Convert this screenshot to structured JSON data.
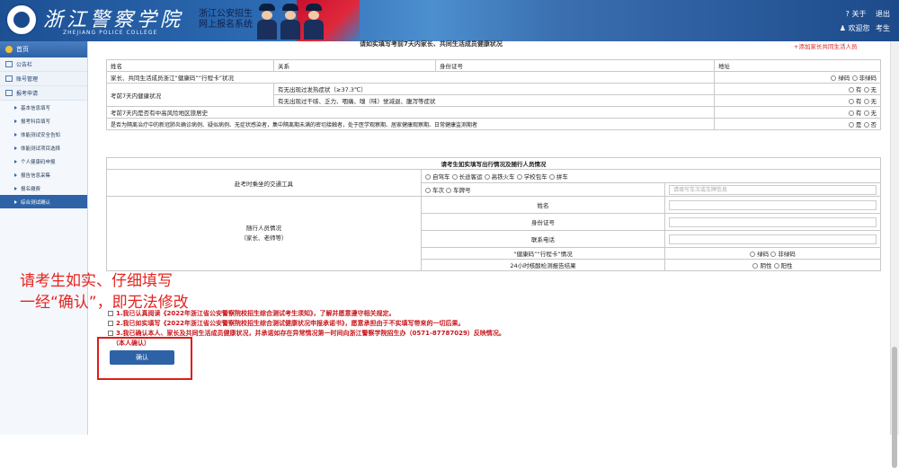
{
  "header": {
    "brand": "浙江警察学院",
    "brand_en": "ZHEJIANG POLICE COLLEGE",
    "subtitle_1": "浙江公安招生",
    "subtitle_2": "网上报名系统",
    "about": "关于",
    "logout": "退出",
    "welcome": "欢迎您",
    "user": "考生"
  },
  "sidebar": {
    "home": "首页",
    "groups": [
      {
        "label": "公告栏"
      },
      {
        "label": "账号管理"
      },
      {
        "label": "报考申请"
      }
    ],
    "items": [
      {
        "label": "基本信息填写"
      },
      {
        "label": "报考科目填写"
      },
      {
        "label": "体能测试安全告知"
      },
      {
        "label": "体能测试项目选择"
      },
      {
        "label": "个人健康码申报"
      },
      {
        "label": "报告信息采集"
      },
      {
        "label": "报名缴费"
      },
      {
        "label": "综合测试确认"
      }
    ]
  },
  "health": {
    "section_title": "请如实填写考前7天内家长、共同生活成员健康状况",
    "add_link": "+添加家长共同生活人员",
    "cols": [
      "姓名",
      "关系",
      "身份证号",
      "地址"
    ],
    "rows": [
      {
        "label": "家长、共同生活成员浙江“健康码”“行程卡”状况",
        "opt_a": "绿码",
        "opt_b": "非绿码"
      },
      {
        "label": "考前7天内健康状况",
        "sub1": "有无出现过发热症状（≥37.3℃）",
        "sub2": "有无出现过干咳、乏力、咽痛、嗅（味）觉减退、腹泻等症状",
        "opt_a": "有",
        "opt_b": "无"
      },
      {
        "label": "考前7天内是否有中高风险地区旅居史",
        "opt_a": "有",
        "opt_b": "无"
      },
      {
        "label": "是否为隔离治疗中的新冠肺炎确诊病例、疑似病例、无症状感染者，集中隔离期未满的密切接触者，处于医学观察期、居家健康观察期、日常健康监测期者",
        "opt_a": "是",
        "opt_b": "否"
      }
    ]
  },
  "travel": {
    "title": "请考生如实填写出行情况及随行人员情况",
    "transport_label": "赴考时乘坐的交通工具",
    "options_row1": [
      "自驾车",
      "长途客运",
      "高铁火车",
      "学校包车",
      "拼车"
    ],
    "options_row2": [
      "车次",
      "车牌号"
    ],
    "transport_placeholder": "请填写车次或车牌信息",
    "companion_label": "随行人员情况",
    "companion_sub": "（家长、老师等）",
    "fields": [
      "姓名",
      "身份证号",
      "联系电话"
    ],
    "health_code_label": "“健康码”“行程卡”情况",
    "health_code_opts": [
      "绿码",
      "非绿码"
    ],
    "test_label": "24小时核酸检测报告结果",
    "test_opts": [
      "阴性",
      "阳性"
    ]
  },
  "consents": [
    "1.我已认真阅读《2022年浙江省公安警察院校招生综合测试考生须知》，了解并愿意遵守相关规定。",
    "2.我已如实填写《2022年浙江省公安警察院校招生综合测试健康状况申报承诺书》，愿意承担由于不实填写带来的一切后果。",
    "3.我已确认本人、家长及共同生活成员健康状况，并承诺如存在异常情况第一时间向浙江警察学院招生办（0571-87787029）反映情况。"
  ],
  "consent_note": "（本人确认）",
  "confirm_button": "确认",
  "annotation": {
    "line1": "请考生如实、仔细填写",
    "line2": "一经“确认”，即无法修改"
  }
}
